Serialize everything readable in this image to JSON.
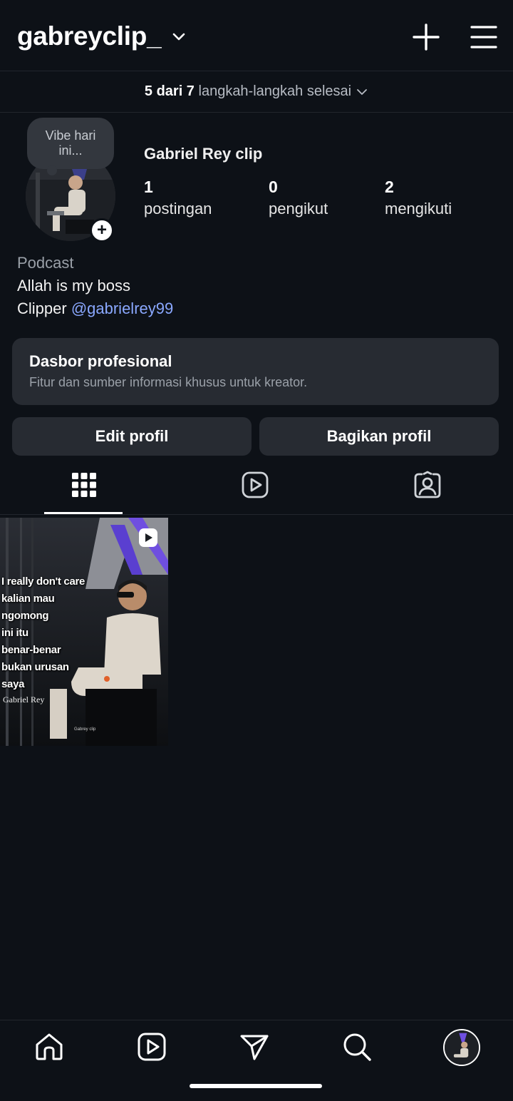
{
  "header": {
    "username": "gabreyclip_",
    "icons": {
      "chevron": "chevron-down-icon",
      "create": "plus-icon",
      "menu": "hamburger-menu-icon"
    }
  },
  "steps": {
    "count": "5 dari 7",
    "text": "langkah-langkah selesai"
  },
  "profile": {
    "note": "Vibe hari ini...",
    "full_name": "Gabriel Rey clip",
    "stats": [
      {
        "value": "1",
        "label": "postingan"
      },
      {
        "value": "0",
        "label": "pengikut"
      },
      {
        "value": "2",
        "label": "mengikuti"
      }
    ],
    "category": "Podcast",
    "bio_line1": "Allah is my boss",
    "bio_line2_prefix": "Clipper ",
    "bio_mention": "@gabrielrey99"
  },
  "dashboard": {
    "title": "Dasbor profesional",
    "subtitle": "Fitur dan sumber informasi khusus untuk kreator."
  },
  "buttons": {
    "edit": "Edit profil",
    "share": "Bagikan profil"
  },
  "tabs": {
    "active": "grid",
    "items": [
      "grid-icon",
      "reels-icon",
      "tagged-icon"
    ]
  },
  "post": {
    "caption_lines": [
      "I really don't care",
      "kalian mau",
      "ngomong",
      "ini itu",
      "benar-benar",
      "bukan urusan",
      "saya"
    ],
    "credit": "Gabriel Rey"
  },
  "bottom_nav": {
    "items": [
      "home-icon",
      "reels-icon",
      "direct-share-icon",
      "search-icon",
      "profile-avatar"
    ]
  },
  "colors": {
    "background": "#0d1117",
    "card": "#272b32",
    "mention": "#8aa8ff",
    "secondary_text": "#9aa0a8"
  }
}
